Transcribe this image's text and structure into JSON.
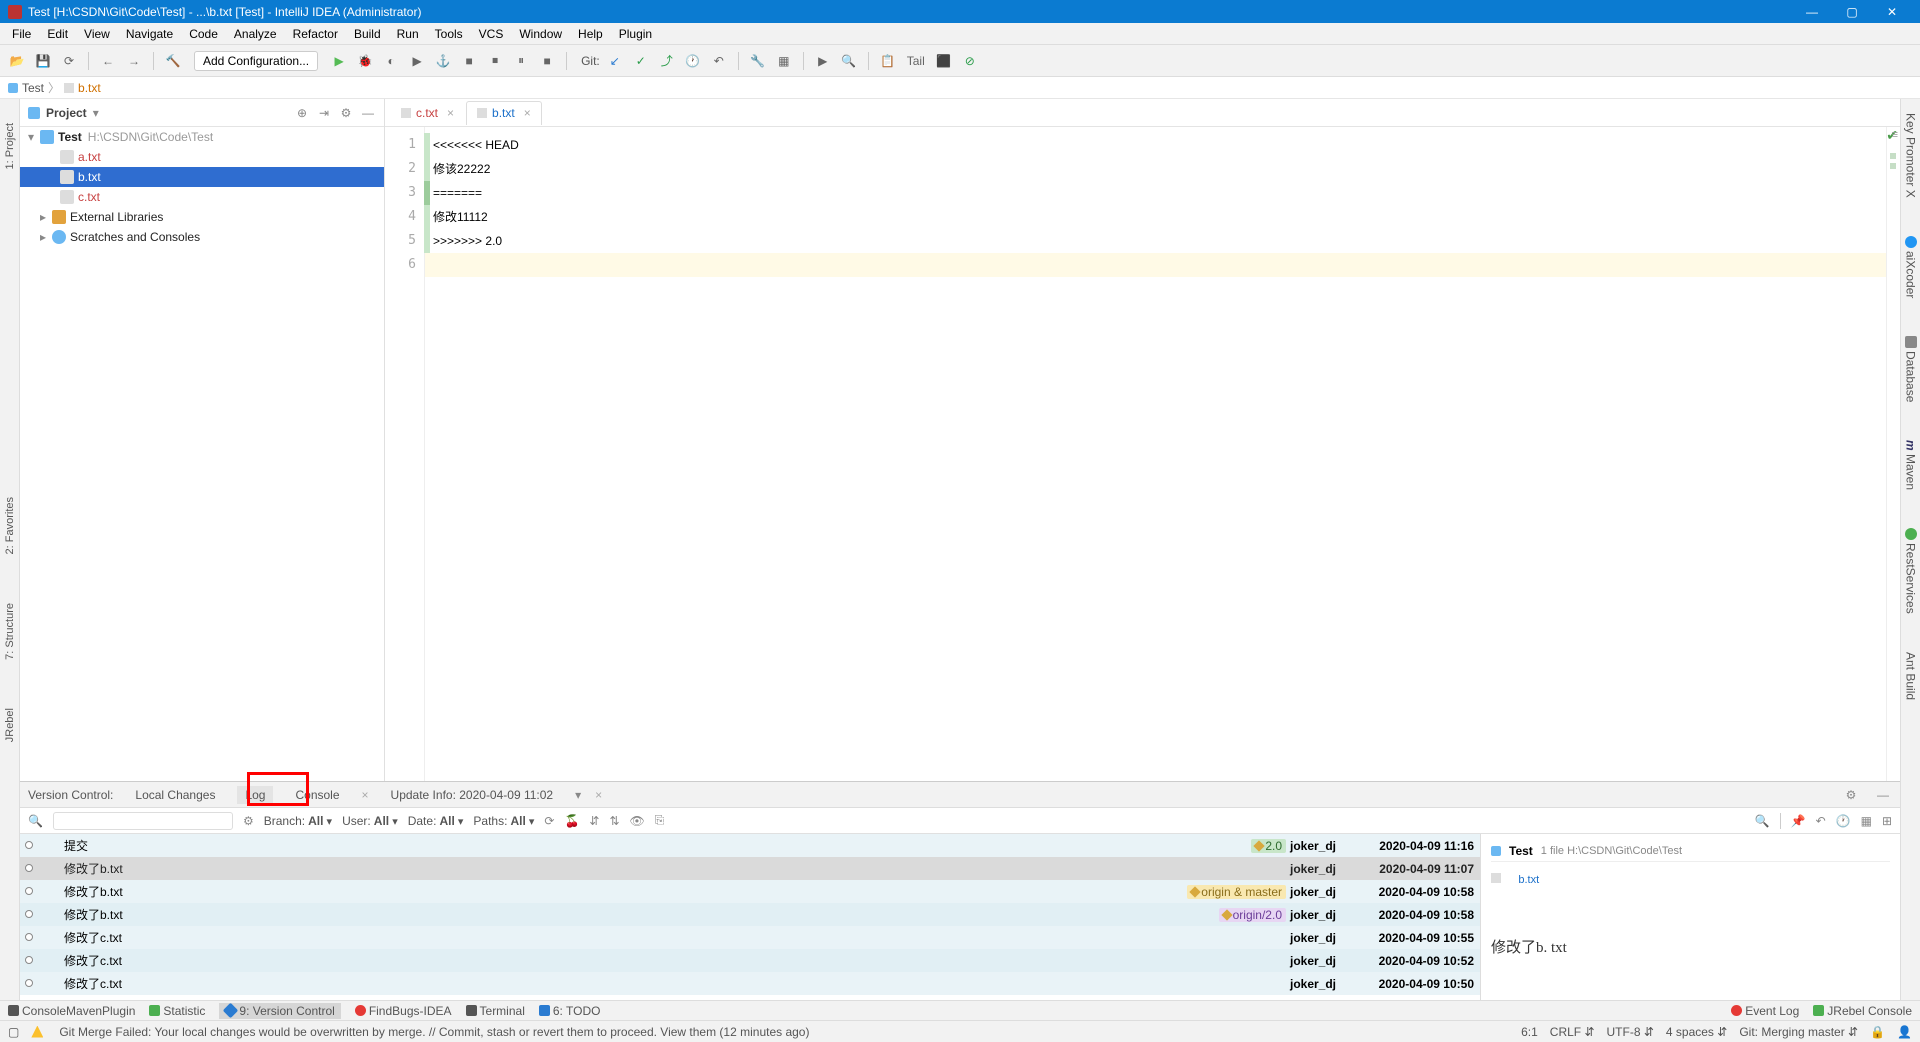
{
  "titlebar": {
    "text": "Test [H:\\CSDN\\Git\\Code\\Test] - ...\\b.txt [Test] - IntelliJ IDEA (Administrator)"
  },
  "menu": [
    "File",
    "Edit",
    "View",
    "Navigate",
    "Code",
    "Analyze",
    "Refactor",
    "Build",
    "Run",
    "Tools",
    "VCS",
    "Window",
    "Help",
    "Plugin"
  ],
  "toolbar": {
    "add_config": "Add Configuration...",
    "git_label": "Git:",
    "tail_label": "Tail"
  },
  "breadcrumb": {
    "root": "Test",
    "file": "b.txt"
  },
  "project": {
    "header": "Project",
    "root_name": "Test",
    "root_path": "H:\\CSDN\\Git\\Code\\Test",
    "files": [
      {
        "name": "a.txt",
        "color": "red"
      },
      {
        "name": "b.txt",
        "color": "normal",
        "selected": true
      },
      {
        "name": "c.txt",
        "color": "red"
      }
    ],
    "external": "External Libraries",
    "scratches": "Scratches and Consoles"
  },
  "tabs": [
    {
      "name": "c.txt",
      "color": "red",
      "active": false
    },
    {
      "name": "b.txt",
      "color": "blue",
      "active": true
    }
  ],
  "editor": {
    "lines": [
      "<<<<<<< HEAD",
      "修该22222",
      "=======",
      "修改11112",
      ">>>>>>> 2.0",
      ""
    ]
  },
  "right_tabs": [
    "Key Promoter X",
    "aiXcoder",
    "Database",
    "Maven",
    "RestServices",
    "Ant Build"
  ],
  "left_tabs": [
    "1: Project",
    "2: Favorites",
    "7: Structure",
    "JRebel"
  ],
  "version_control": {
    "label": "Version Control:",
    "tab_local": "Local Changes",
    "tab_log": "Log",
    "tab_console": "Console",
    "update_info": "Update Info: 2020-04-09 11:02",
    "filter": {
      "placeholder": "",
      "branch_label": "Branch:",
      "branch_val": "All",
      "user_label": "User:",
      "user_val": "All",
      "date_label": "Date:",
      "date_val": "All",
      "paths_label": "Paths:",
      "paths_val": "All"
    },
    "commits": [
      {
        "msg": "提交",
        "tags": [
          {
            "text": "2.0",
            "cls": "green"
          }
        ],
        "author": "joker_dj",
        "date": "2020-04-09 11:16"
      },
      {
        "msg": "修改了b.txt",
        "tags": [],
        "author": "joker_dj",
        "date": "2020-04-09 11:07",
        "selected": true
      },
      {
        "msg": "修改了b.txt",
        "tags": [
          {
            "text": "origin & master",
            "cls": "yellow"
          }
        ],
        "author": "joker_dj",
        "date": "2020-04-09 10:58"
      },
      {
        "msg": "修改了b.txt",
        "tags": [
          {
            "text": "origin/2.0",
            "cls": "purple"
          }
        ],
        "author": "joker_dj",
        "date": "2020-04-09 10:58"
      },
      {
        "msg": "修改了c.txt",
        "tags": [],
        "author": "joker_dj",
        "date": "2020-04-09 10:55"
      },
      {
        "msg": "修改了c.txt",
        "tags": [],
        "author": "joker_dj",
        "date": "2020-04-09 10:52"
      },
      {
        "msg": "修改了c.txt",
        "tags": [],
        "author": "joker_dj",
        "date": "2020-04-09 10:50"
      }
    ],
    "detail": {
      "path_root": "Test",
      "path_info": "1 file  H:\\CSDN\\Git\\Code\\Test",
      "file": "b.txt",
      "message": "修改了b. txt"
    }
  },
  "bottombar": {
    "items": [
      "ConsoleMavenPlugin",
      "Statistic",
      "9: Version Control",
      "FindBugs-IDEA",
      "Terminal",
      "6: TODO"
    ],
    "event_log": "Event Log",
    "jrebel": "JRebel Console"
  },
  "status": {
    "msg": "Git Merge Failed: Your local changes would be overwritten by merge. // Commit, stash or revert them to proceed. View them (12 minutes ago)",
    "pos": "6:1",
    "crlf": "CRLF",
    "enc": "UTF-8",
    "spaces": "4 spaces",
    "branch": "Git: Merging master"
  }
}
